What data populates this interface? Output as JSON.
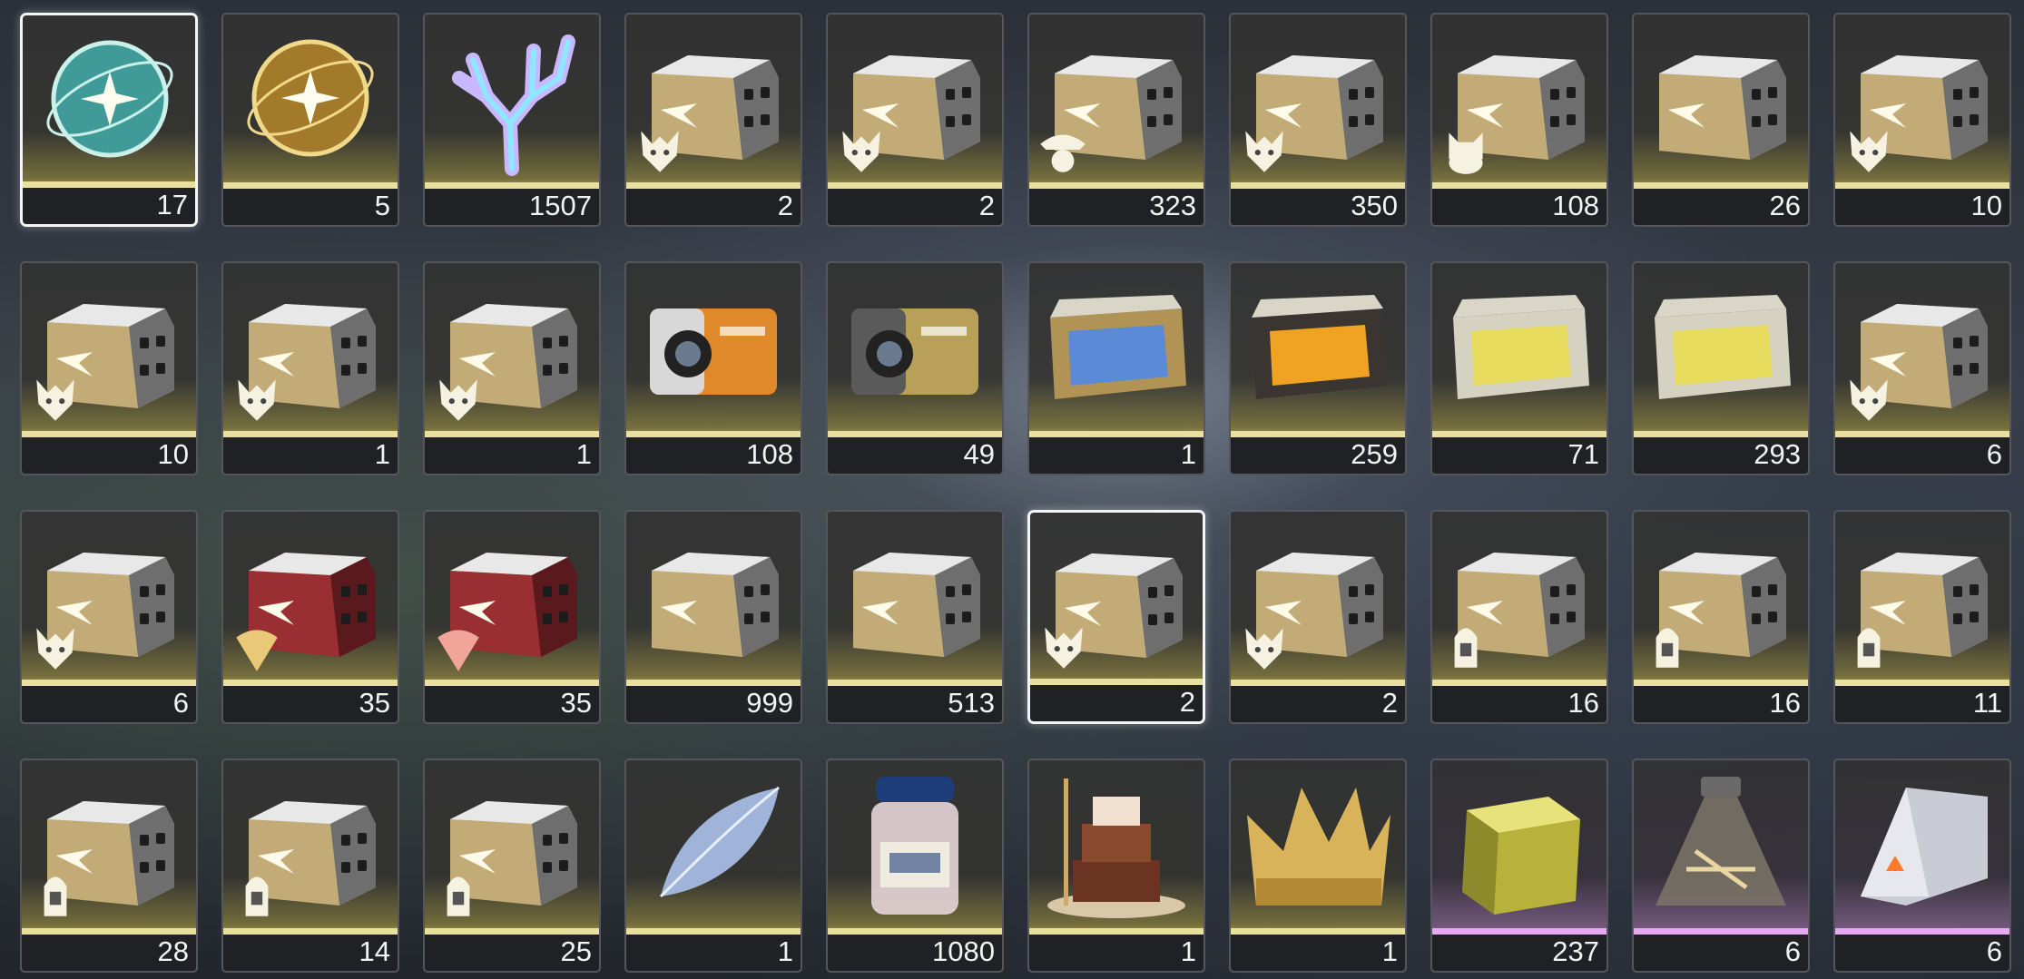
{
  "inventory": {
    "items": [
      {
        "icon": "teal-sphere-icon",
        "count": "17",
        "rarity": "gold",
        "selected": true
      },
      {
        "icon": "gold-sphere-icon",
        "count": "5",
        "rarity": "gold"
      },
      {
        "icon": "crystal-coral-icon",
        "count": "1507",
        "rarity": "gold"
      },
      {
        "icon": "silver-crate-wolf-icon",
        "count": "2",
        "rarity": "gold"
      },
      {
        "icon": "silver-crate-wolf-icon",
        "count": "2",
        "rarity": "gold"
      },
      {
        "icon": "silver-crate-pirate-icon",
        "count": "323",
        "rarity": "gold"
      },
      {
        "icon": "silver-crate-wolf-icon",
        "count": "350",
        "rarity": "gold"
      },
      {
        "icon": "silver-crate-cat-icon",
        "count": "108",
        "rarity": "gold"
      },
      {
        "icon": "silver-crate-icon",
        "count": "26",
        "rarity": "gold"
      },
      {
        "icon": "silver-crate-wolf-icon",
        "count": "10",
        "rarity": "gold"
      },
      {
        "icon": "silver-crate-wolf-icon",
        "count": "10",
        "rarity": "gold"
      },
      {
        "icon": "silver-crate-wolf-icon",
        "count": "1",
        "rarity": "gold"
      },
      {
        "icon": "silver-crate-wolf-icon",
        "count": "1",
        "rarity": "gold"
      },
      {
        "icon": "orange-device-crate-icon",
        "count": "108",
        "rarity": "gold"
      },
      {
        "icon": "mechanical-crate-icon",
        "count": "49",
        "rarity": "gold"
      },
      {
        "icon": "blue-gold-crate-icon",
        "count": "1",
        "rarity": "gold"
      },
      {
        "icon": "orange-glow-crate-icon",
        "count": "259",
        "rarity": "gold"
      },
      {
        "icon": "yellow-glow-crate-icon",
        "count": "71",
        "rarity": "gold"
      },
      {
        "icon": "yellow-glow-crate-icon",
        "count": "293",
        "rarity": "gold"
      },
      {
        "icon": "silver-crate-wolf-icon",
        "count": "6",
        "rarity": "gold"
      },
      {
        "icon": "silver-crate-wolf-icon",
        "count": "6",
        "rarity": "gold"
      },
      {
        "icon": "red-crate-gold-emblem-icon",
        "count": "35",
        "rarity": "gold"
      },
      {
        "icon": "red-crate-pink-emblem-icon",
        "count": "35",
        "rarity": "gold"
      },
      {
        "icon": "silver-crate-icon",
        "count": "999",
        "rarity": "gold"
      },
      {
        "icon": "silver-crate-icon",
        "count": "513",
        "rarity": "gold"
      },
      {
        "icon": "silver-crate-wolf-icon",
        "count": "2",
        "rarity": "gold",
        "selected": true
      },
      {
        "icon": "silver-crate-wolf-icon",
        "count": "2",
        "rarity": "gold"
      },
      {
        "icon": "silver-crate-helmet-icon",
        "count": "16",
        "rarity": "gold"
      },
      {
        "icon": "silver-crate-helmet-icon",
        "count": "16",
        "rarity": "gold"
      },
      {
        "icon": "silver-crate-helmet-icon",
        "count": "11",
        "rarity": "gold"
      },
      {
        "icon": "silver-crate-helmet-icon",
        "count": "28",
        "rarity": "gold"
      },
      {
        "icon": "silver-crate-helmet-icon",
        "count": "14",
        "rarity": "gold"
      },
      {
        "icon": "silver-crate-helmet-icon",
        "count": "25",
        "rarity": "gold"
      },
      {
        "icon": "crystal-leaf-icon",
        "count": "1",
        "rarity": "gold"
      },
      {
        "icon": "salt-jar-icon",
        "count": "1080",
        "rarity": "gold"
      },
      {
        "icon": "cake-icon",
        "count": "1",
        "rarity": "gold"
      },
      {
        "icon": "gold-crown-icon",
        "count": "1",
        "rarity": "gold"
      },
      {
        "icon": "gold-cube-icon",
        "count": "237",
        "rarity": "purple"
      },
      {
        "icon": "glass-flask-icon",
        "count": "6",
        "rarity": "purple"
      },
      {
        "icon": "triangle-device-icon",
        "count": "6",
        "rarity": "purple"
      }
    ]
  },
  "colors": {
    "gold_stripe": "#e9df9e",
    "purple_stripe": "#e7a9f2",
    "count_bar": "#202124",
    "selected_border": "#f5f5f5"
  }
}
